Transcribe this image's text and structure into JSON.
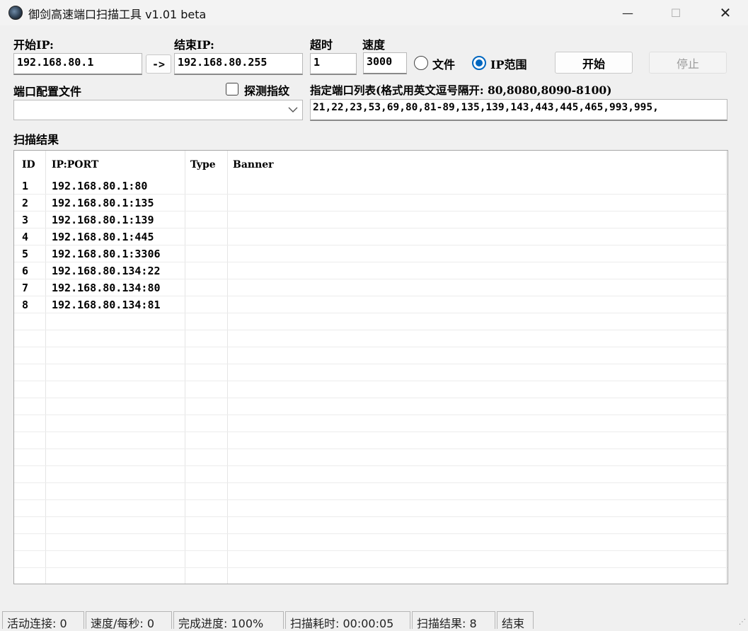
{
  "window": {
    "title": "御剑高速端口扫描工具 v1.01 beta",
    "min_icon": "minimize-icon",
    "max_icon": "maximize-icon",
    "close_icon": "close-icon",
    "min_glyph": "—",
    "max_glyph": "☐",
    "close_glyph": "✕"
  },
  "form": {
    "start_ip_label": "开始IP:",
    "start_ip_value": "192.168.80.1",
    "arrow_label": "->",
    "end_ip_label": "结束IP:",
    "end_ip_value": "192.168.80.255",
    "timeout_label": "超时",
    "timeout_value": "1",
    "speed_label": "速度",
    "speed_value": "3000",
    "radio_file_label": "文件",
    "radio_range_label": "IP范围",
    "selected_mode": "IP范围",
    "start_button": "开始",
    "stop_button": "停止",
    "port_config_label": "端口配置文件",
    "port_config_value": "",
    "probe_fingerprint_label": "探测指纹",
    "probe_fingerprint_checked": false,
    "port_list_label": "指定端口列表(格式用英文逗号隔开: 80,8080,8090-8100)",
    "port_list_value": "21,22,23,53,69,80,81-89,135,139,143,443,445,465,993,995,"
  },
  "results": {
    "title": "扫描结果",
    "columns": [
      "ID",
      "IP:PORT",
      "Type",
      "Banner"
    ],
    "rows": [
      {
        "id": "1",
        "ipport": "192.168.80.1:80",
        "type": "",
        "banner": ""
      },
      {
        "id": "2",
        "ipport": "192.168.80.1:135",
        "type": "",
        "banner": ""
      },
      {
        "id": "3",
        "ipport": "192.168.80.1:139",
        "type": "",
        "banner": ""
      },
      {
        "id": "4",
        "ipport": "192.168.80.1:445",
        "type": "",
        "banner": ""
      },
      {
        "id": "5",
        "ipport": "192.168.80.1:3306",
        "type": "",
        "banner": ""
      },
      {
        "id": "6",
        "ipport": "192.168.80.134:22",
        "type": "",
        "banner": ""
      },
      {
        "id": "7",
        "ipport": "192.168.80.134:80",
        "type": "",
        "banner": ""
      },
      {
        "id": "8",
        "ipport": "192.168.80.134:81",
        "type": "",
        "banner": ""
      }
    ]
  },
  "status": {
    "active_connections": "活动连接: 0",
    "speed": "速度/每秒: 0",
    "progress": "完成进度: 100%",
    "elapsed": "扫描耗时: 00:00:05",
    "result_count": "扫描结果: 8",
    "state": "结束"
  },
  "colors": {
    "accent": "#0067c0",
    "window_bg": "#f0f0f0"
  }
}
